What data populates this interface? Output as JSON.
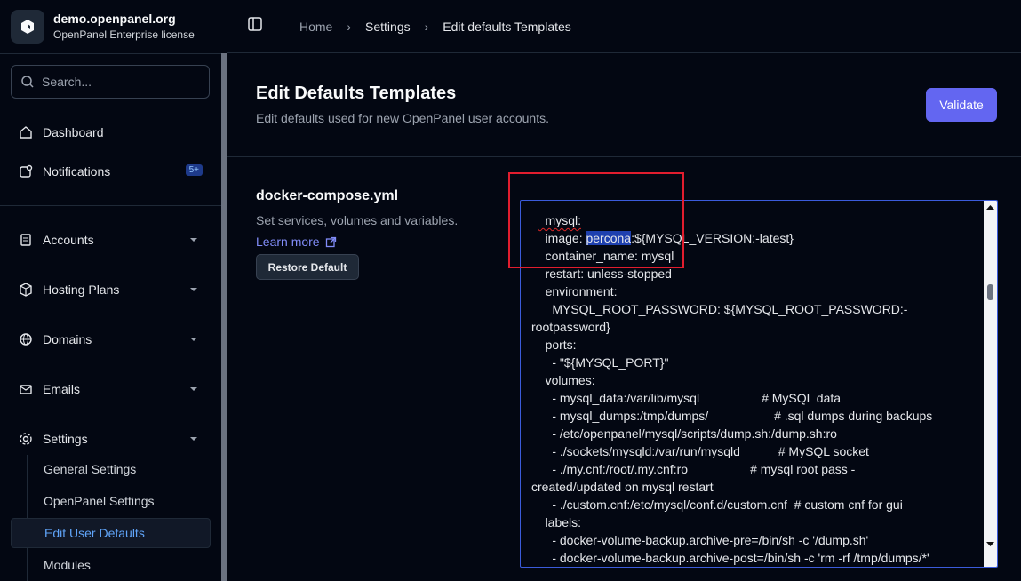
{
  "brand": {
    "title": "demo.openpanel.org",
    "subtitle": "OpenPanel Enterprise license"
  },
  "search": {
    "placeholder": "Search..."
  },
  "nav": {
    "dashboard": "Dashboard",
    "notifications": "Notifications",
    "notifications_badge": "5+",
    "accounts": "Accounts",
    "hosting_plans": "Hosting Plans",
    "domains": "Domains",
    "emails": "Emails",
    "settings": "Settings",
    "sub": {
      "general": "General Settings",
      "openpanel": "OpenPanel Settings",
      "edit_user_defaults": "Edit User Defaults",
      "modules": "Modules"
    }
  },
  "breadcrumb": {
    "home": "Home",
    "settings": "Settings",
    "current": "Edit defaults Templates"
  },
  "page": {
    "title": "Edit Defaults Templates",
    "description": "Edit defaults used for new OpenPanel user accounts.",
    "validate_label": "Validate"
  },
  "section": {
    "title": "docker-compose.yml",
    "description": "Set services, volumes and variables.",
    "learn_more": "Learn more",
    "restore_label": "Restore Default"
  },
  "editor": {
    "lines": [
      "  mysql:",
      "    image: percona:${MYSQL_VERSION:-latest}",
      "    container_name: mysql",
      "    restart: unless-stopped",
      "    environment:",
      "      MYSQL_ROOT_PASSWORD: ${MYSQL_ROOT_PASSWORD:-",
      "rootpassword}",
      "    ports:",
      "      - \"${MYSQL_PORT}\"",
      "    volumes:",
      "      - mysql_data:/var/lib/mysql                  # MySQL data",
      "      - mysql_dumps:/tmp/dumps/                   # .sql dumps during backups",
      "      - /etc/openpanel/mysql/scripts/dump.sh:/dump.sh:ro",
      "      - ./sockets/mysqld:/var/run/mysqld           # MySQL socket",
      "      - ./my.cnf:/root/.my.cnf:ro                  # mysql root pass -",
      "created/updated on mysql restart",
      "      - ./custom.cnf:/etc/mysql/conf.d/custom.cnf  # custom cnf for gui",
      "    labels:",
      "      - docker-volume-backup.archive-pre=/bin/sh -c '/dump.sh'",
      "      - docker-volume-backup.archive-post=/bin/sh -c 'rm -rf /tmp/dumps/*'"
    ],
    "selected_word": "percona"
  },
  "colors": {
    "accent": "#6366f1",
    "active_link": "#60a5fa",
    "highlight_box": "#e11d2e"
  }
}
